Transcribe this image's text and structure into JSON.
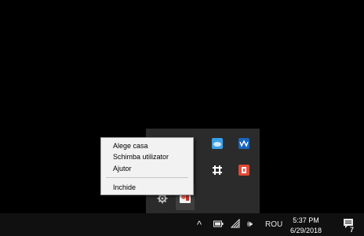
{
  "context_menu": {
    "items": [
      {
        "label": "Alege casa"
      },
      {
        "label": "Schimba utilizator"
      },
      {
        "label": "Ajutor"
      },
      {
        "label": "Inchide"
      }
    ]
  },
  "tray_flyout": {
    "icons": [
      {
        "name": "blue-app-icon",
        "color": "#1e90d6"
      },
      {
        "name": "onedrive-icon",
        "color": "#3aa0e8"
      },
      {
        "name": "wave-app-icon",
        "color": "#1565c0"
      },
      {
        "name": "slack-icon",
        "color": "#ffffff"
      },
      {
        "name": "red-app-icon",
        "color": "#e24a35"
      },
      {
        "name": "gear-icon",
        "color": "#bfbfbf"
      },
      {
        "name": "user-app-icon",
        "color": "#e86a5a"
      }
    ]
  },
  "taskbar": {
    "chevron_glyph": "^",
    "language": "ROU",
    "volume_glyph": "🕪",
    "clock": {
      "time": "5:37 PM",
      "date": "6/29/2018"
    },
    "notification_count": "7",
    "accent": "#101010"
  }
}
